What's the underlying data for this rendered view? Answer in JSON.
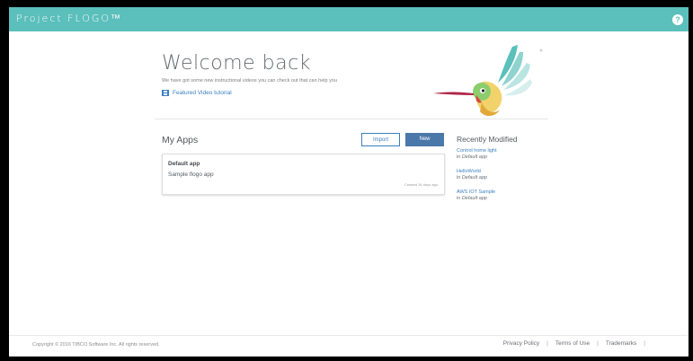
{
  "header": {
    "brand": "Project FLOGO™",
    "help_label": "?"
  },
  "welcome": {
    "title": "Welcome back",
    "subtitle": "We have got some new instructional videos you can check out that can help you",
    "video_link": "Featured Video tutorial"
  },
  "my_apps": {
    "title": "My Apps",
    "import_label": "Import",
    "new_label": "New",
    "apps": [
      {
        "name": "Default app",
        "description": "Sample flogo app",
        "created": "Created 16 days ago"
      }
    ]
  },
  "recently_modified": {
    "title": "Recently Modified",
    "items": [
      {
        "name": "Control home light",
        "prefix": "in",
        "app": "Default app"
      },
      {
        "name": "HelloWorld",
        "prefix": "in",
        "app": "Default app"
      },
      {
        "name": "AWS IOT Sample",
        "prefix": "in",
        "app": "Default app"
      }
    ]
  },
  "footer": {
    "copyright": "Copyright © 2016 TIBCO Software Inc. All rights reserved.",
    "privacy": "Privacy Policy",
    "terms": "Terms of Use",
    "trademarks": "Trademarks",
    "separator": "|"
  },
  "colors": {
    "topbar": "#5bbfbb",
    "link": "#3a7fc0",
    "primary_button": "#4a78a8"
  },
  "icons": {
    "help": "help-circle-icon",
    "video": "film-icon",
    "mascot": "hummingbird-logo"
  }
}
